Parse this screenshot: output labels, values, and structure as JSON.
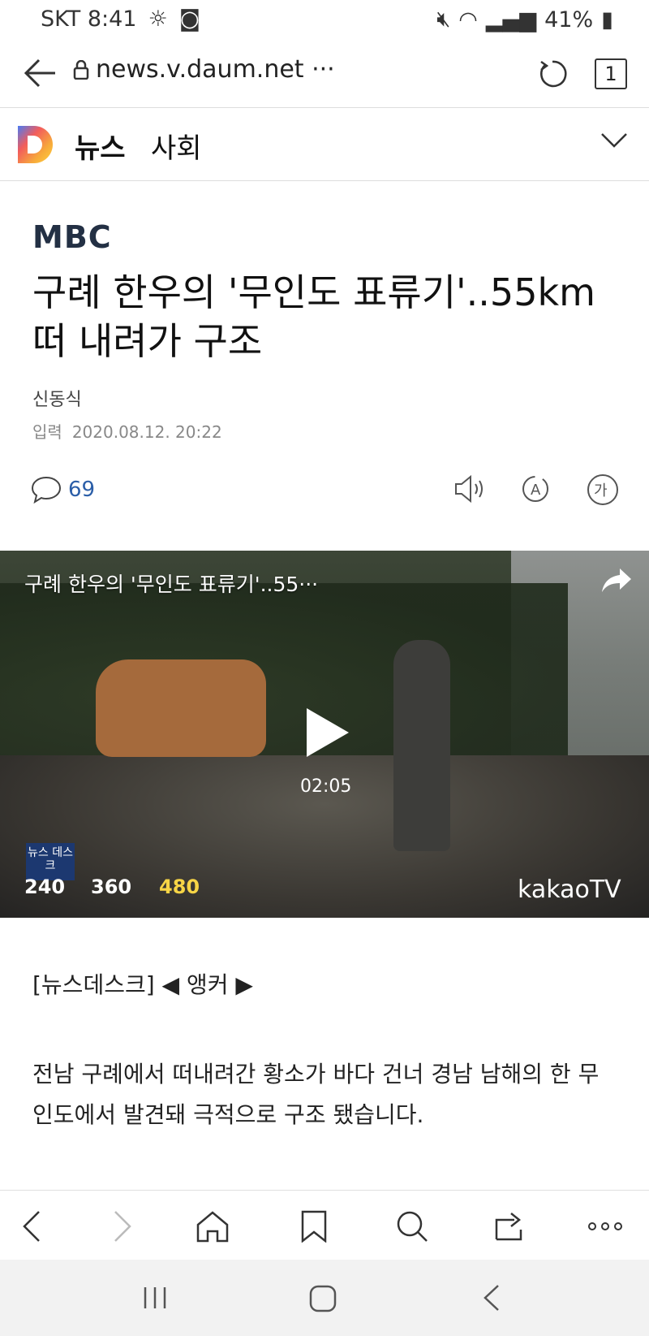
{
  "status_bar": {
    "carrier_time": "SKT 8:41",
    "battery": "41%"
  },
  "browser": {
    "url": "news.v.daum.net ···",
    "tab_count": "1"
  },
  "site": {
    "section": "뉴스",
    "subsection": "사회"
  },
  "article": {
    "publisher": "MBC",
    "title": "구례 한우의 '무인도 표류기'..55km 떠 내려가 구조",
    "author": "신동식",
    "date_label": "입력",
    "date": "2020.08.12. 20:22",
    "comment_count": "69"
  },
  "video": {
    "title": "구례 한우의 '무인도 표류기'..55···",
    "duration": "02:05",
    "qualities": [
      "240",
      "360",
      "480"
    ],
    "selected_quality": "480",
    "badge": "뉴스 데스크",
    "provider": "kakaoTV"
  },
  "body": {
    "p1": "[뉴스데스크] ◀ 앵커 ▶",
    "p2": "전남 구례에서 떠내려간 황소가 바다 건너 경남 남해의 한 무인도에서 발견돼 극적으로 구조 됐습니다."
  },
  "colors": {
    "link_blue": "#2b5ea8",
    "selected_quality": "#f7d546",
    "mbc_navy": "#233044"
  }
}
